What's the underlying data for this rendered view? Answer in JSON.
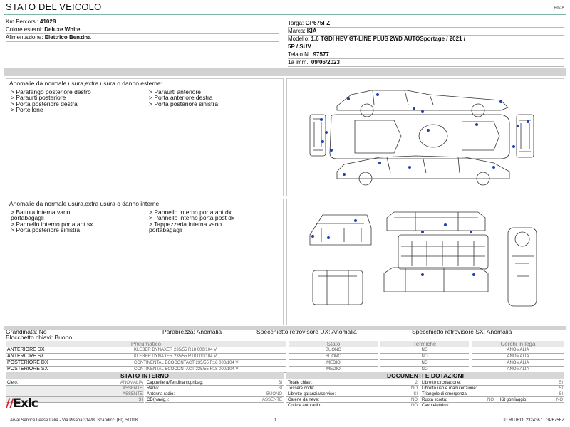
{
  "header": {
    "title": "STATO DEL VEICOLO",
    "rev": "Rev. A"
  },
  "vehicle_left": [
    {
      "label": "Km Percorsi:",
      "value": "41028"
    },
    {
      "label": "Colore esterni:",
      "value": "Deluxe White"
    },
    {
      "label": "Alimentazione:",
      "value": "Elettrico Benzina"
    }
  ],
  "vehicle_right": {
    "targa_label": "Targa:",
    "targa": "GP675FZ",
    "marca_label": "Marca:",
    "marca": "KIA",
    "modello_label": "Modello:",
    "modello_1": "1.6 TGDI HEV GT-LINE PLUS 2WD AUTOSportage / 2021 /",
    "modello_2": "5P / SUV",
    "telaio_label": "Telaio N.:",
    "telaio": "97577",
    "imm_label": "1a imm.:",
    "imm": "09/06/2023"
  },
  "exterior": {
    "title": "Anomalie da normale usura,extra usura o danno esterne:",
    "col1": [
      "> Parafango posteriore destro",
      "> Paraurti posteriore",
      "> Porta posteriore destra",
      "> Portellone"
    ],
    "col2": [
      "> Paraurti anteriore",
      "> Porta anteriore destra",
      "> Porta posteriore sinistra"
    ]
  },
  "interior": {
    "title": "Anomalie da normale usura,extra usura o danno interne:",
    "col1": [
      "> Battuta interna vano",
      "portabagagli",
      "> Pannello interno porta ant sx",
      "> Porta posteriore sinistra"
    ],
    "col2": [
      "> Pannello interno porta ant dx",
      "> Pannello interno porta post dx",
      "> Tappezzeria interna vano",
      "portabagagli"
    ]
  },
  "summary": {
    "grandinata": "Grandinata: No",
    "blocchetto": "Blocchetto chiavi: Buono",
    "parabrezza": "Parabrezza: Anomalia",
    "specchio_dx": "Specchietto retrovisore DX: Anomalia",
    "specchio_sx": "Specchietto retrovisore SX: Anomalia"
  },
  "tires": {
    "headers": [
      "Pneumatico",
      "Stato",
      "Termiche",
      "Cerchi in lega"
    ],
    "rows": [
      {
        "pos": "ANTERIORE DX",
        "model": "KLEBER DYNAXER 235/55 R18 000/104 V",
        "stato": "BUONO",
        "termiche": "NO",
        "cerchi": "ANOMALIA"
      },
      {
        "pos": "ANTERIORE SX",
        "model": "KLEBER DYNAXER 235/55 R18 000/104 V",
        "stato": "BUONO",
        "termiche": "NO",
        "cerchi": "ANOMALIA"
      },
      {
        "pos": "POSTERIORE DX",
        "model": "CONTINENTAL ECOCONTACT 235/55 R18 000/104 V",
        "stato": "MEDIO",
        "termiche": "NO",
        "cerchi": "ANOMALIA"
      },
      {
        "pos": "POSTERIORE SX",
        "model": "CONTINENTAL ECOCONTACT 235/55 R18 000/104 V",
        "stato": "MEDIO",
        "termiche": "NO",
        "cerchi": "ANOMALIA"
      }
    ]
  },
  "stato_interno": {
    "title": "STATO INTERNO",
    "left": [
      {
        "label": "Cielo:",
        "value": "ANOMALIA"
      },
      {
        "label": "",
        "value": "ASSENTE"
      },
      {
        "label": "",
        "value": "ASSENTE"
      },
      {
        "label": "",
        "value": "SI"
      }
    ],
    "right": [
      {
        "label": "Cappelliera/Tendina copribag:",
        "value": "SI"
      },
      {
        "label": "Radio:",
        "value": "SI"
      },
      {
        "label": "Antenna radio:",
        "value": "BUONO"
      },
      {
        "label": "CD(Navig.):",
        "value": "ASSENTE"
      }
    ]
  },
  "documenti": {
    "title": "DOCUMENTI E DOTAZIONI",
    "left": [
      {
        "label": "Totale chiavi:",
        "value": "2"
      },
      {
        "label": "Tessere code:",
        "value": "NO"
      },
      {
        "label": "Libretto garanzia/service:",
        "value": "SI"
      },
      {
        "label": "Catene da neve:",
        "value": "NO"
      },
      {
        "label": "Codice autoradio:",
        "value": "NO"
      }
    ],
    "right": [
      {
        "label": "Libretto circolazione:",
        "value": "SI"
      },
      {
        "label": "Libretto uso e manutenzione:",
        "value": "SI"
      },
      {
        "label": "Triangolo di emergenza:",
        "value": "SI"
      },
      {
        "label": "Ruota scorta:",
        "value": "NO"
      },
      {
        "label": "Cavo elettrico:",
        "value": ""
      }
    ],
    "kit_label": "Kit gonfiaggio:",
    "kit_value": "NO"
  },
  "footer": {
    "logo_bars": "//",
    "logo_text": "Exlc",
    "company": "Arval Service Lease Italia - Via Pisana 314/B, Scandicci (FI), 50018",
    "page": "1",
    "ritiro": "ID RITIRO: 2324367 | GP675FZ"
  },
  "colors": {
    "accent_green": "#7fb5a9",
    "marker_blue": "#1f3fb5",
    "logo_red": "#d9262b"
  }
}
